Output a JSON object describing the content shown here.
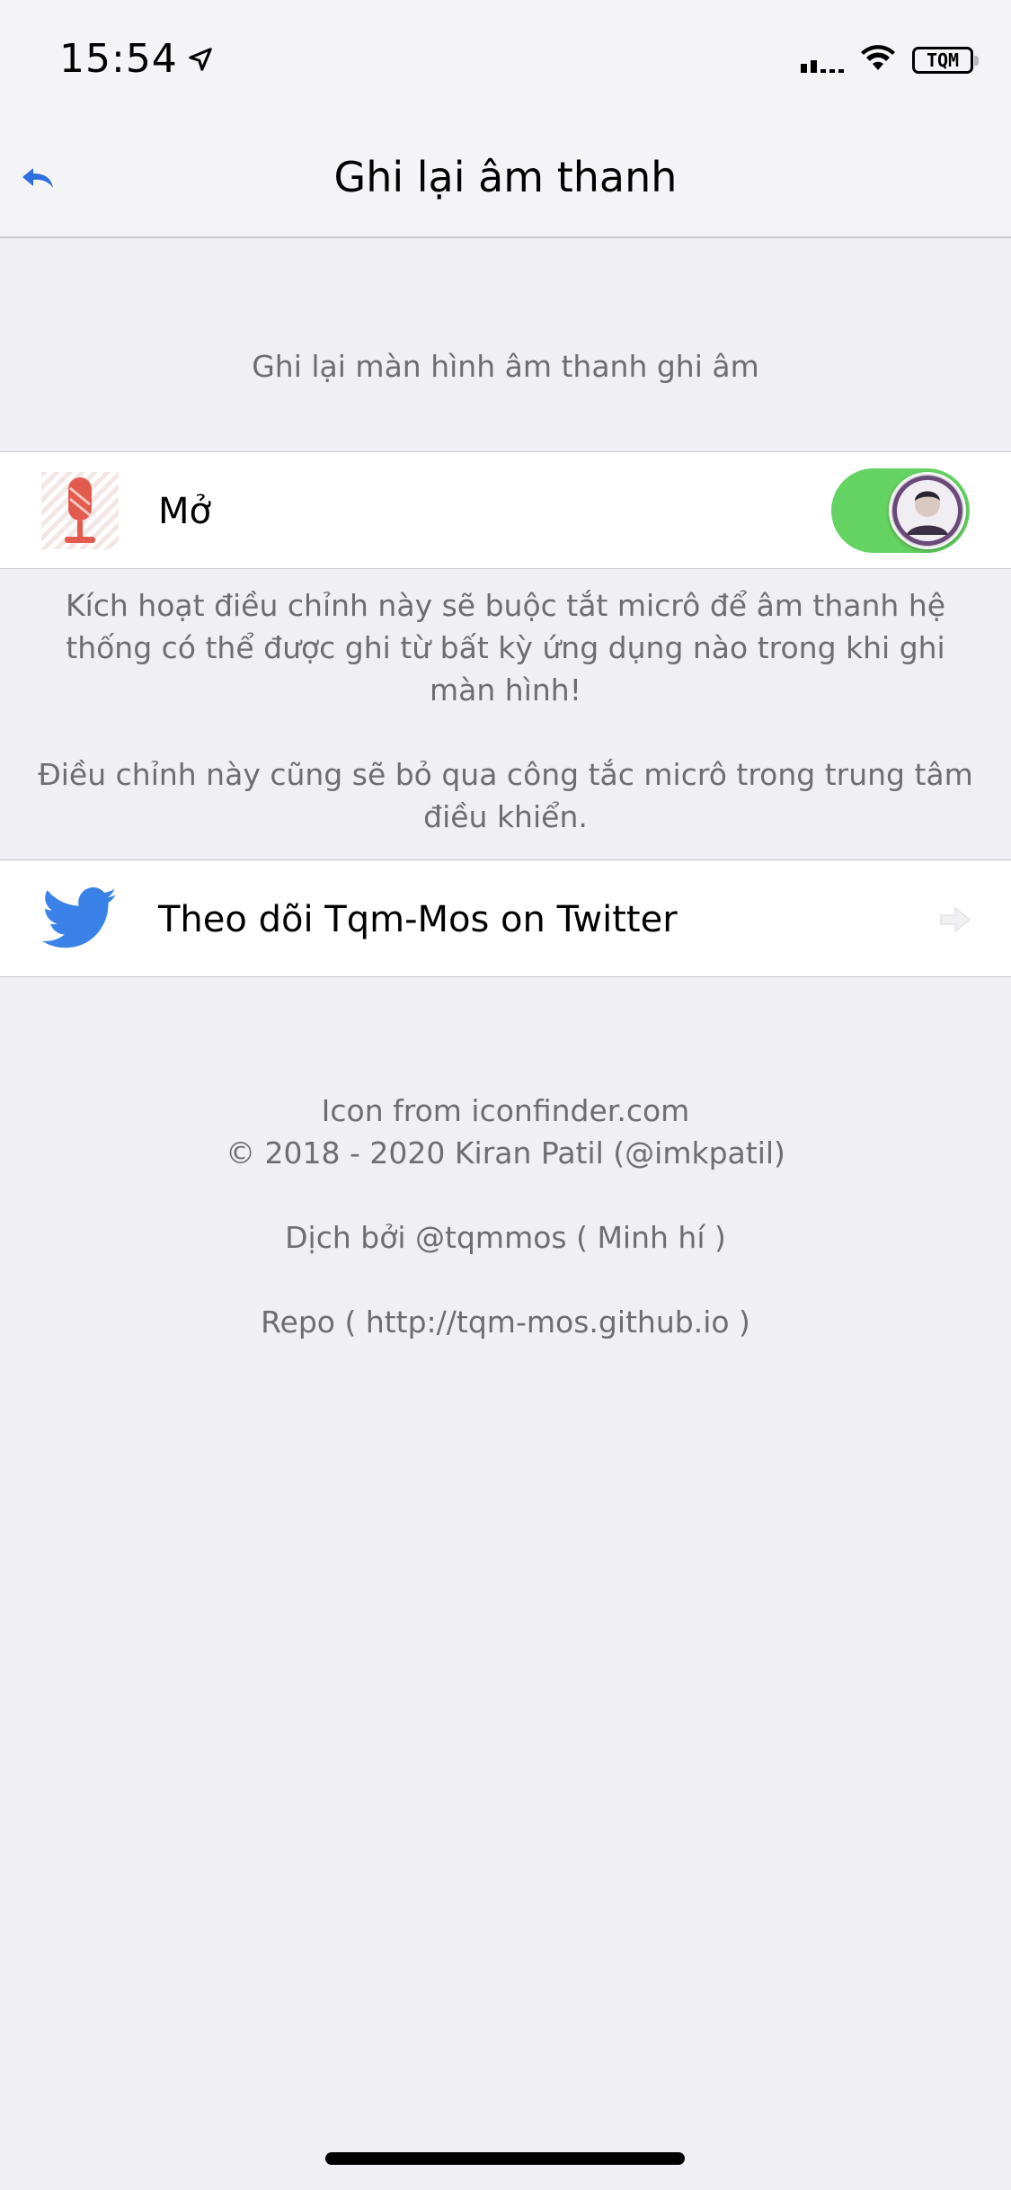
{
  "status_bar": {
    "time": "15:54",
    "location_icon": "location-arrow-icon",
    "carrier_text": "TQM",
    "wifi_icon": "wifi-icon"
  },
  "nav": {
    "title": "Ghi lại âm thanh",
    "back_icon": "reply-arrow-icon",
    "accent_color": "#2f6fe0"
  },
  "section": {
    "header": "Ghi lại màn hình âm thanh ghi âm"
  },
  "mic_cell": {
    "label": "Mở",
    "icon": "microphone-icon",
    "toggle_on": true,
    "toggle_color": "#65d362",
    "footer_1": "Kích hoạt điều chỉnh này sẽ buộc tắt micrô để âm thanh hệ thống có thể được ghi từ bất kỳ ứng dụng nào trong khi ghi màn hình!",
    "footer_2": "Điều chỉnh này cũng sẽ bỏ qua công tắc micrô trong trung tâm điều khiển."
  },
  "twitter_cell": {
    "label": "Theo dõi Tqm-Mos on Twitter",
    "icon": "twitter-bird-icon",
    "icon_color": "#3b82e8"
  },
  "credits": {
    "line1": "Icon from iconfinder.com",
    "line2": "© 2018 - 2020 Kiran Patil (@imkpatil)",
    "line3": "Dịch bởi @tqmmos ( Minh hí )",
    "line4": "Repo ( http://tqm-mos.github.io )"
  }
}
